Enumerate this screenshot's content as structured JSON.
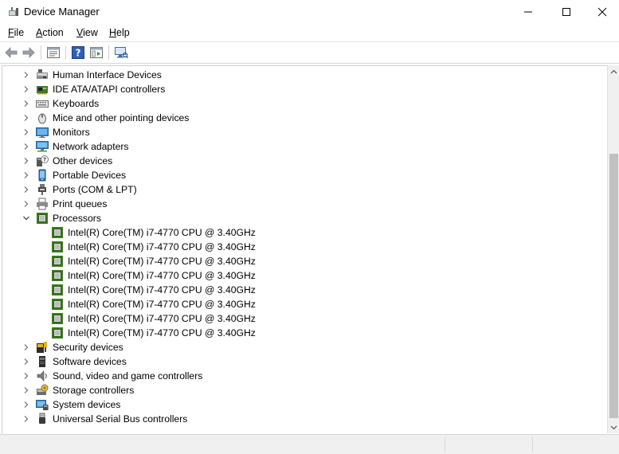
{
  "window": {
    "title": "Device Manager",
    "controls": {
      "minimize": "minimize",
      "maximize": "maximize",
      "close": "close"
    }
  },
  "menubar": [
    {
      "label": "File",
      "accel": "F",
      "rest": "ile"
    },
    {
      "label": "Action",
      "accel": "A",
      "rest": "ction"
    },
    {
      "label": "View",
      "accel": "V",
      "rest": "iew"
    },
    {
      "label": "Help",
      "accel": "H",
      "rest": "elp"
    }
  ],
  "toolbar": {
    "icons": [
      "back-arrow-icon",
      "forward-arrow-icon",
      "properties-icon",
      "help-icon",
      "show-hide-console-tree-icon",
      "scan-hardware-icon"
    ]
  },
  "tree": {
    "categories_before": [
      {
        "label": "Human Interface Devices",
        "icon": "hid-icon"
      },
      {
        "label": "IDE ATA/ATAPI controllers",
        "icon": "ide-controller-icon"
      },
      {
        "label": "Keyboards",
        "icon": "keyboard-icon"
      },
      {
        "label": "Mice and other pointing devices",
        "icon": "mouse-icon"
      },
      {
        "label": "Monitors",
        "icon": "monitor-icon"
      },
      {
        "label": "Network adapters",
        "icon": "network-adapter-icon"
      },
      {
        "label": "Other devices",
        "icon": "unknown-device-icon"
      },
      {
        "label": "Portable Devices",
        "icon": "portable-device-icon"
      },
      {
        "label": "Ports (COM & LPT)",
        "icon": "port-icon"
      },
      {
        "label": "Print queues",
        "icon": "printer-icon"
      }
    ],
    "expanded": {
      "label": "Processors",
      "icon": "processor-icon",
      "children": [
        "Intel(R) Core(TM) i7-4770 CPU @ 3.40GHz",
        "Intel(R) Core(TM) i7-4770 CPU @ 3.40GHz",
        "Intel(R) Core(TM) i7-4770 CPU @ 3.40GHz",
        "Intel(R) Core(TM) i7-4770 CPU @ 3.40GHz",
        "Intel(R) Core(TM) i7-4770 CPU @ 3.40GHz",
        "Intel(R) Core(TM) i7-4770 CPU @ 3.40GHz",
        "Intel(R) Core(TM) i7-4770 CPU @ 3.40GHz",
        "Intel(R) Core(TM) i7-4770 CPU @ 3.40GHz"
      ]
    },
    "categories_after": [
      {
        "label": "Security devices",
        "icon": "security-device-icon"
      },
      {
        "label": "Software devices",
        "icon": "software-device-icon"
      },
      {
        "label": "Sound, video and game controllers",
        "icon": "speaker-icon"
      },
      {
        "label": "Storage controllers",
        "icon": "storage-controller-icon"
      },
      {
        "label": "System devices",
        "icon": "system-device-icon"
      },
      {
        "label": "Universal Serial Bus controllers",
        "icon": "usb-icon"
      }
    ]
  },
  "colors": {
    "accent": "#0078d7",
    "processor_green": "#3c7a1e",
    "scrollbar_thumb": "#c1c1c1"
  }
}
